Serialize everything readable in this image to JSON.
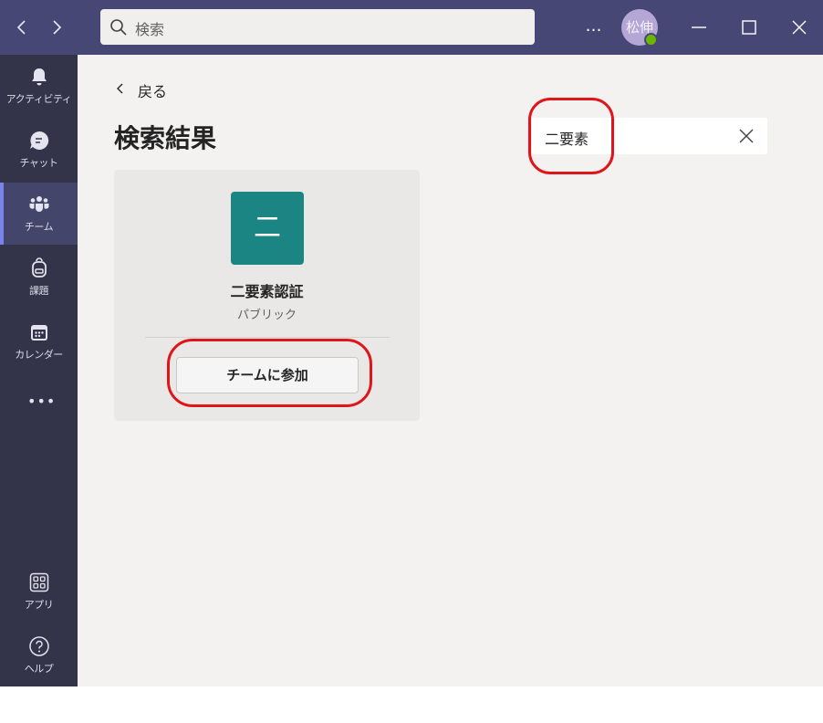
{
  "titlebar": {
    "search_placeholder": "検索",
    "more": "…",
    "avatar_initials": "松伸"
  },
  "rail": {
    "items": [
      {
        "label": "アクティビティ",
        "icon": "bell-icon"
      },
      {
        "label": "チャット",
        "icon": "chat-icon"
      },
      {
        "label": "チーム",
        "icon": "teams-icon"
      },
      {
        "label": "課題",
        "icon": "backpack-icon"
      },
      {
        "label": "カレンダー",
        "icon": "calendar-icon"
      }
    ],
    "more": "•••",
    "bottom": [
      {
        "label": "アプリ",
        "icon": "apps-icon"
      },
      {
        "label": "ヘルプ",
        "icon": "help-icon"
      }
    ]
  },
  "main": {
    "back_label": "戻る",
    "title": "検索結果",
    "query": "二要素"
  },
  "result_card": {
    "tile_text": "二",
    "name": "二要素認証",
    "visibility": "パブリック",
    "join_label": "チームに参加"
  },
  "colors": {
    "titlebar": "#464775",
    "rail": "#33344a",
    "accent": "#7b83eb",
    "tile": "#1b8584",
    "annotation": "#e0151a"
  }
}
